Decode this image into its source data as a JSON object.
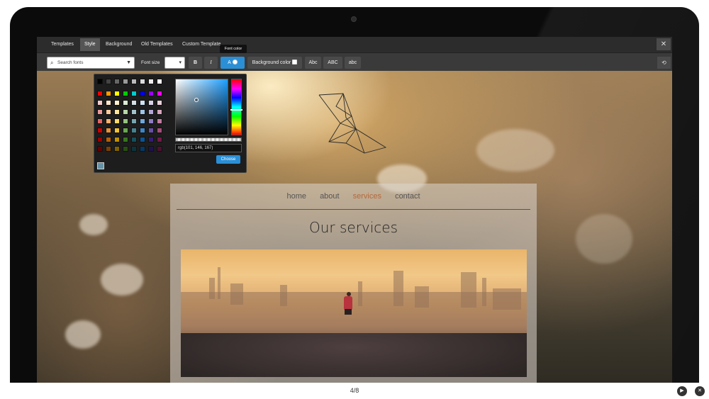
{
  "editor": {
    "tabs": [
      {
        "label": "Templates"
      },
      {
        "label": "Style"
      },
      {
        "label": "Background"
      },
      {
        "label": "Old Templates"
      },
      {
        "label": "Custom Template"
      }
    ],
    "close_glyph": "✕",
    "toolbar": {
      "search_placeholder": "Search fonts",
      "font_size_label": "Font size",
      "font_size_glyph": "▾",
      "bold_label": "B",
      "italic_label": "I",
      "font_color_label": "A",
      "font_color_tooltip": "Font color",
      "background_color_label": "Background color",
      "case_title": "Abc",
      "case_upper": "ABC",
      "case_lower": "abc"
    },
    "color_picker": {
      "rgb_value": "rgb(101, 146, 167)",
      "choose_label": "Choose",
      "current_color": "#6592a7"
    }
  },
  "site": {
    "nav": [
      {
        "label": "home"
      },
      {
        "label": "about"
      },
      {
        "label": "services",
        "active": true
      },
      {
        "label": "contact"
      }
    ],
    "page_title": "Our services"
  },
  "slideshow": {
    "counter": "4/8"
  },
  "icons": {
    "search": "search-icon",
    "chevron": "chevron-down-icon",
    "refresh": "refresh-icon",
    "play": "play-icon",
    "close": "close-icon"
  },
  "colors": {
    "accent_blue": "#2b8fd6",
    "nav_active": "#b6683a"
  }
}
